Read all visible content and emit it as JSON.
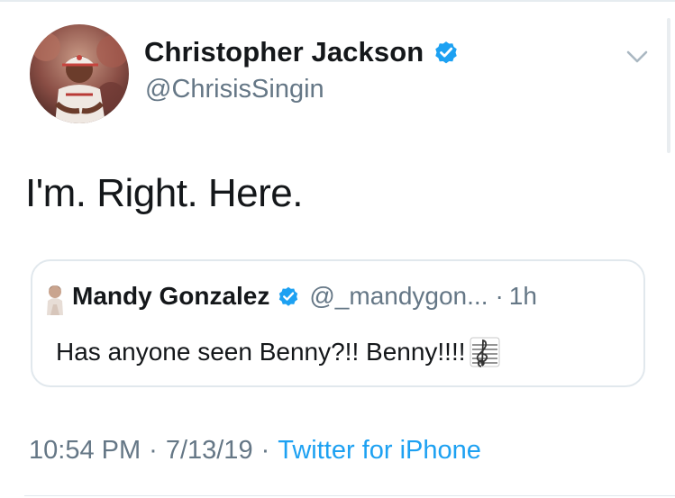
{
  "author": {
    "display_name": "Christopher Jackson",
    "handle": "@ChrisisSingin",
    "verified": true
  },
  "tweet": {
    "text": "I'm. Right. Here."
  },
  "quoted_tweet": {
    "display_name": "Mandy Gonzalez",
    "handle": "@_mandygon...",
    "separator": "·",
    "time": "1h",
    "verified": true,
    "text": "Has anyone seen Benny?!!  Benny!!!!"
  },
  "meta": {
    "time": "10:54 PM",
    "separator1": "·",
    "date": "7/13/19",
    "separator2": "·",
    "source": "Twitter for iPhone"
  },
  "icons": {
    "verified": "verified-badge-icon",
    "chevron": "chevron-down-icon",
    "music": "musical-score-emoji"
  },
  "colors": {
    "link_blue": "#1da1f2",
    "secondary_text": "#657786",
    "primary_text": "#14171a",
    "border": "#e1e8ed"
  }
}
